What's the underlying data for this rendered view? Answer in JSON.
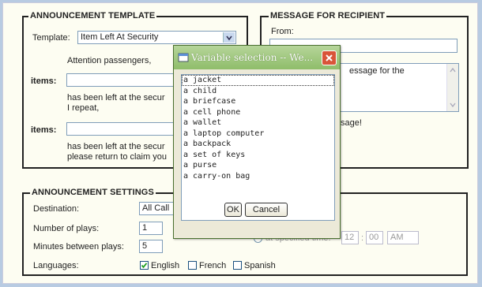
{
  "template_section": {
    "legend": "ANNOUNCEMENT TEMPLATE",
    "template_label": "Template:",
    "template_value": "Item Left At Security",
    "line1": "Attention passengers,",
    "items1_label": "items:",
    "line2a": "has been left at the secur",
    "line2b": "I repeat,",
    "items2_label": "items:",
    "line3a": "has been left at the secur",
    "line3b": "please return to claim you"
  },
  "message_section": {
    "legend": "MESSAGE FOR RECIPIENT",
    "from_label": "From:",
    "message_partial": "essage for the",
    "note_partial": "sage!"
  },
  "settings_section": {
    "legend": "ANNOUNCEMENT SETTINGS",
    "destination_label": "Destination:",
    "destination_value": "All Call",
    "plays_label": "Number of plays:",
    "plays_value": "1",
    "minutes_label": "Minutes between plays:",
    "minutes_value": "5",
    "languages_label": "Languages:",
    "languages": [
      {
        "label": "English",
        "checked": true
      },
      {
        "label": "French",
        "checked": false
      },
      {
        "label": "Spanish",
        "checked": false
      }
    ],
    "specified_time_label": "at specified time:",
    "hour": "12",
    "minute": "00",
    "ampm": "AM"
  },
  "dialog": {
    "title": "Variable selection -- We...",
    "items": [
      "a jacket",
      "a child",
      "a briefcase",
      "a cell phone",
      "a wallet",
      "a laptop computer",
      "a backpack",
      "a set of keys",
      "a purse",
      "a carry-on bag"
    ],
    "selected_index": 0,
    "ok_label": "OK",
    "cancel_label": "Cancel"
  },
  "colors": {
    "titlebar": "#8fbd6a",
    "close": "#d9553a",
    "background": "#b8cbe2"
  }
}
